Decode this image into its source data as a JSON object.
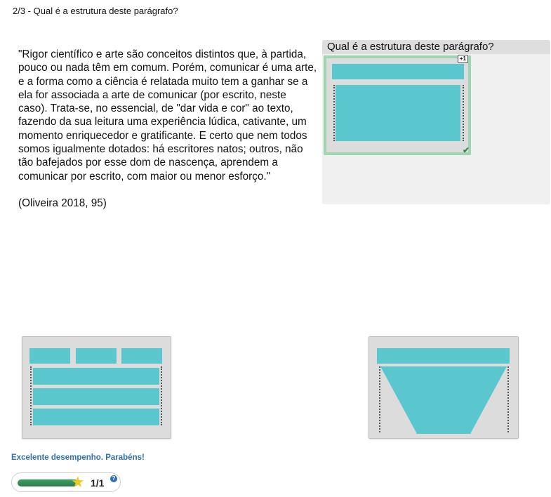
{
  "header": {
    "progress_title": "2/3 - Qual é a estrutura deste parágrafo?"
  },
  "paragraph": {
    "text": "\"Rigor científico e arte são conceitos distintos que, à partida, pouco ou nada têm em comum. Porém, comunicar é uma arte, e a forma como a ciência é relatada muito tem a ganhar se a ela for associada a arte de comunicar (por escrito, neste caso). Trata-se, no essencial, de \"dar vida e cor\" ao texto, fazendo da sua leitura uma experiência lúdica, cativante, um momento enriquecedor e gratificante. E certo que nem todos somos igualmente dotados: há escritores natos; outros, não tão bafejados por esse dom de nascença, aprendem a comunicar por escrito, com maior ou menor esforço.\"",
    "citation": "(Oliveira 2018, 95)"
  },
  "dropzone": {
    "title": "Qual é a estrutura deste parágrafo?",
    "badge": "+1",
    "check_icon": "checkmark-icon"
  },
  "options": [
    {
      "name": "three-columns-with-rows-structure"
    },
    {
      "name": "inverted-funnel-structure"
    }
  ],
  "feedback": {
    "message": "Excelente desempenho. Parabéns!"
  },
  "score": {
    "value": "1/1",
    "progress": 1.0,
    "star_icon": "star-icon",
    "help_icon": "help-icon",
    "help_glyph": "?"
  },
  "colors": {
    "teal": "#5ac6ce",
    "card": "#dcdcdc",
    "correct_border": "#9ed6b1",
    "feedback": "#2f6fb3"
  }
}
